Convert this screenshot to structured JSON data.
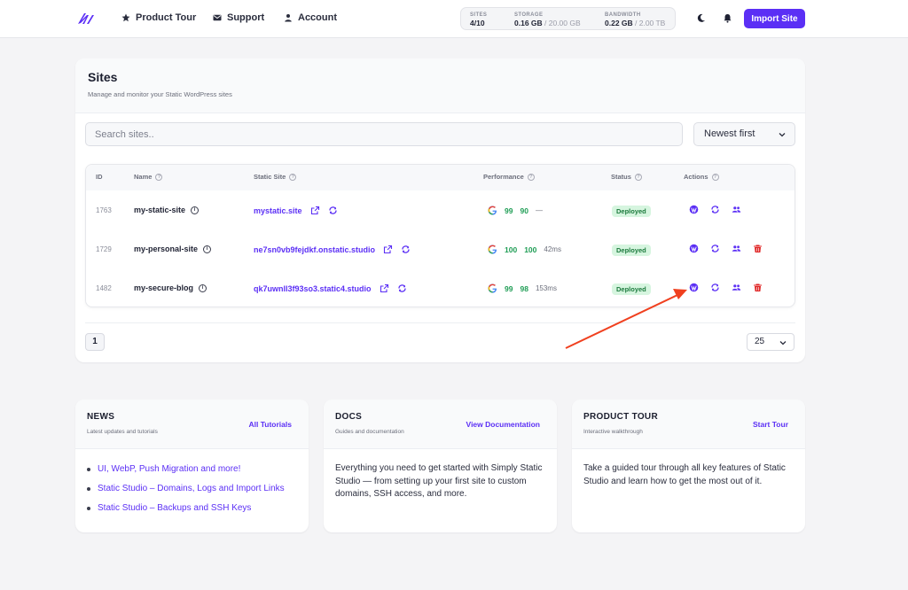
{
  "nav": {
    "items": [
      {
        "label": "Product Tour",
        "icon": "star-icon"
      },
      {
        "label": "Support",
        "icon": "envelope-icon"
      },
      {
        "label": "Account",
        "icon": "user-icon"
      }
    ],
    "stats": [
      {
        "label": "SITES",
        "value": "4/10",
        "muted": ""
      },
      {
        "label": "STORAGE",
        "value": "0.16 GB",
        "muted": " / 20.00 GB"
      },
      {
        "label": "BANDWIDTH",
        "value": "0.22 GB",
        "muted": " / 2.00 TB"
      }
    ],
    "import_label": "Import Site"
  },
  "sites": {
    "title": "Sites",
    "subtitle": "Manage and monitor your Static WordPress sites",
    "search_placeholder": "Search sites..",
    "sort_value": "Newest first",
    "columns": [
      "ID",
      "Name",
      "Static Site",
      "Performance",
      "Status",
      "Actions"
    ],
    "rows": [
      {
        "id": "1763",
        "name": "my-static-site",
        "static_site": "mystatic.site",
        "perf_a": "99",
        "perf_b": "90",
        "perf_ms": "—",
        "status": "Deployed",
        "deletable": false
      },
      {
        "id": "1729",
        "name": "my-personal-site",
        "static_site": "ne7sn0vb9fejdkf.onstatic.studio",
        "perf_a": "100",
        "perf_b": "100",
        "perf_ms": "42ms",
        "status": "Deployed",
        "deletable": true
      },
      {
        "id": "1482",
        "name": "my-secure-blog",
        "static_site": "qk7uwnll3f93so3.static4.studio",
        "perf_a": "99",
        "perf_b": "98",
        "perf_ms": "153ms",
        "status": "Deployed",
        "deletable": true
      }
    ],
    "page": "1",
    "per_page": "25"
  },
  "news": {
    "title": "NEWS",
    "subtitle": "Latest updates and tutorials",
    "link": "All Tutorials",
    "items": [
      "UI, WebP, Push Migration and more!",
      "Static Studio – Domains, Logs and Import Links",
      "Static Studio – Backups and SSH Keys"
    ]
  },
  "docs": {
    "title": "DOCS",
    "subtitle": "Guides and documentation",
    "link": "View Documentation",
    "body": "Everything you need to get started with Simply Static Studio — from setting up your first site to custom domains, SSH access, and more."
  },
  "tour": {
    "title": "PRODUCT TOUR",
    "subtitle": "Interactive walkthrough",
    "link": "Start Tour",
    "body": "Take a guided tour through all key features of Static Studio and learn how to get the most out of it."
  },
  "colors": {
    "accent": "#5b2ff5",
    "success": "#1f9d55",
    "danger": "#e02424",
    "annotation": "#f0401f"
  }
}
